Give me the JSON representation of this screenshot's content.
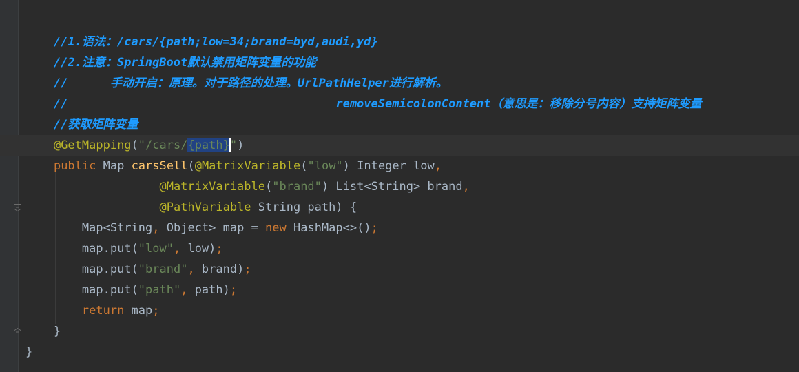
{
  "editor": {
    "lines": [
      {
        "indent": "    ",
        "parts": [
          {
            "cls": "cmt-b",
            "text": "//1.语法：/cars/{path;low=34;brand=byd,audi,yd}"
          }
        ]
      },
      {
        "indent": "    ",
        "parts": [
          {
            "cls": "cmt-b",
            "text": "//2.注意：SpringBoot默认禁用矩阵变量的功能"
          }
        ]
      },
      {
        "indent": "    ",
        "parts": [
          {
            "cls": "cmt-b",
            "text": "//      手动开启：原理。对于路径的处理。UrlPathHelper进行解析。"
          }
        ]
      },
      {
        "indent": "    ",
        "parts": [
          {
            "cls": "cmt-b",
            "text": "//                                      removeSemicolonContent（意思是：移除分号内容）支持矩阵变量"
          }
        ]
      },
      {
        "indent": "    ",
        "parts": [
          {
            "cls": "cmt-b",
            "text": "//获取矩阵变量"
          }
        ]
      },
      {
        "indent": "    ",
        "current": true,
        "parts": [
          {
            "cls": "ann",
            "text": "@GetMapping"
          },
          {
            "cls": "plain",
            "text": "("
          },
          {
            "cls": "str",
            "text": "\"/cars/"
          },
          {
            "cls": "str sel",
            "text": "{path}"
          },
          {
            "cls": "caret",
            "text": ""
          },
          {
            "cls": "str",
            "text": "\""
          },
          {
            "cls": "plain",
            "text": ")"
          }
        ]
      },
      {
        "indent": "    ",
        "parts": [
          {
            "cls": "kw",
            "text": "public "
          },
          {
            "cls": "plain",
            "text": "Map "
          },
          {
            "cls": "fn",
            "text": "carsSell"
          },
          {
            "cls": "plain",
            "text": "("
          },
          {
            "cls": "ann",
            "text": "@MatrixVariable"
          },
          {
            "cls": "plain",
            "text": "("
          },
          {
            "cls": "str",
            "text": "\"low\""
          },
          {
            "cls": "plain",
            "text": ") Integer low"
          },
          {
            "cls": "punc",
            "text": ","
          }
        ]
      },
      {
        "indent": "                   ",
        "parts": [
          {
            "cls": "ann",
            "text": "@MatrixVariable"
          },
          {
            "cls": "plain",
            "text": "("
          },
          {
            "cls": "str",
            "text": "\"brand\""
          },
          {
            "cls": "plain",
            "text": ") List<String> brand"
          },
          {
            "cls": "punc",
            "text": ","
          }
        ]
      },
      {
        "indent": "                   ",
        "parts": [
          {
            "cls": "ann",
            "text": "@PathVariable "
          },
          {
            "cls": "plain",
            "text": "String path) {"
          }
        ]
      },
      {
        "indent": "        ",
        "parts": [
          {
            "cls": "plain",
            "text": "Map<String"
          },
          {
            "cls": "punc",
            "text": ", "
          },
          {
            "cls": "plain",
            "text": "Object> map = "
          },
          {
            "cls": "kw",
            "text": "new "
          },
          {
            "cls": "plain",
            "text": "HashMap<>()"
          },
          {
            "cls": "punc",
            "text": ";"
          }
        ]
      },
      {
        "indent": "        ",
        "parts": [
          {
            "cls": "plain",
            "text": "map.put("
          },
          {
            "cls": "str",
            "text": "\"low\""
          },
          {
            "cls": "punc",
            "text": ", "
          },
          {
            "cls": "plain",
            "text": "low)"
          },
          {
            "cls": "punc",
            "text": ";"
          }
        ]
      },
      {
        "indent": "        ",
        "parts": [
          {
            "cls": "plain",
            "text": "map.put("
          },
          {
            "cls": "str",
            "text": "\"brand\""
          },
          {
            "cls": "punc",
            "text": ", "
          },
          {
            "cls": "plain",
            "text": "brand)"
          },
          {
            "cls": "punc",
            "text": ";"
          }
        ]
      },
      {
        "indent": "        ",
        "parts": [
          {
            "cls": "plain",
            "text": "map.put("
          },
          {
            "cls": "str",
            "text": "\"path\""
          },
          {
            "cls": "punc",
            "text": ", "
          },
          {
            "cls": "plain",
            "text": "path)"
          },
          {
            "cls": "punc",
            "text": ";"
          }
        ]
      },
      {
        "indent": "        ",
        "parts": [
          {
            "cls": "kw",
            "text": "return "
          },
          {
            "cls": "plain",
            "text": "map"
          },
          {
            "cls": "punc",
            "text": ";"
          }
        ]
      },
      {
        "indent": "    ",
        "parts": [
          {
            "cls": "plain",
            "text": "}"
          }
        ]
      },
      {
        "indent": "",
        "parts": [
          {
            "cls": "plain",
            "text": "}"
          }
        ]
      }
    ]
  },
  "gutter": {
    "fold_icons": [
      "fold-open-icon",
      "fold-close-icon"
    ]
  },
  "colors": {
    "background": "#2b2b2b",
    "comment": "#2b95e0",
    "annotation": "#bbb529",
    "string": "#6a8759",
    "keyword": "#cc7832",
    "method": "#ffc66d",
    "text": "#a9b7c6",
    "selection": "#214283"
  }
}
